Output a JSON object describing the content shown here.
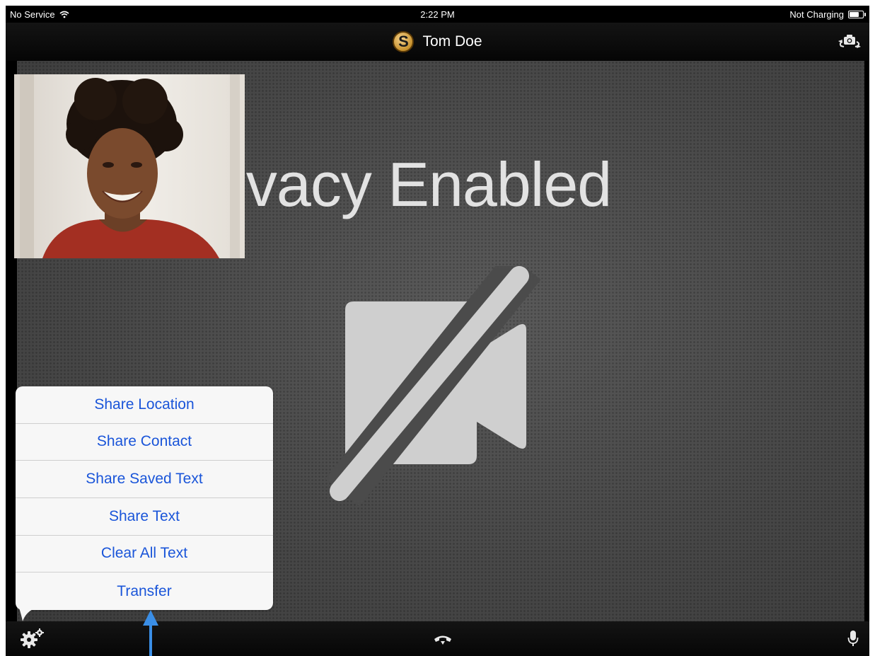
{
  "status_bar": {
    "carrier": "No Service",
    "time": "2:22 PM",
    "battery_status": "Not Charging"
  },
  "title_bar": {
    "caller_name": "Tom Doe",
    "logo_letter": "S"
  },
  "video": {
    "privacy_message": "eo Privacy Enabled"
  },
  "menu": {
    "items": [
      {
        "label": "Share Location"
      },
      {
        "label": "Share Contact"
      },
      {
        "label": "Share Saved Text"
      },
      {
        "label": "Share Text"
      },
      {
        "label": "Clear All Text"
      },
      {
        "label": "Transfer"
      }
    ]
  },
  "icons": {
    "wifi": "wifi-icon",
    "battery": "battery-icon",
    "logo": "app-logo-icon",
    "camera_switch": "camera-switch-icon",
    "video_off": "video-off-icon",
    "settings": "gear-icon",
    "hangup": "hangup-icon",
    "microphone": "microphone-icon"
  },
  "colors": {
    "menu_text": "#1a55d9",
    "annotation_arrow": "#3a8ee6",
    "video_background": "#4b4b4b"
  }
}
